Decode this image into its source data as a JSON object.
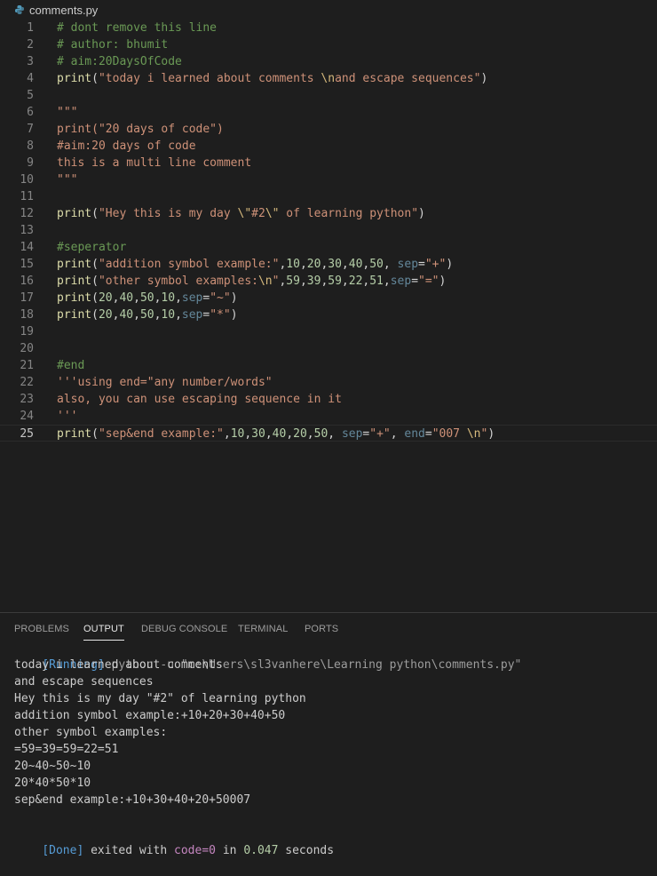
{
  "breadcrumb": {
    "file": "comments.py"
  },
  "editor": {
    "lines": [
      {
        "n": "1",
        "tokens": [
          {
            "t": "# dont remove this line",
            "c": "t-comment"
          }
        ]
      },
      {
        "n": "2",
        "tokens": [
          {
            "t": "# author: bhumit",
            "c": "t-comment"
          }
        ]
      },
      {
        "n": "3",
        "tokens": [
          {
            "t": "# aim:20DaysOfCode",
            "c": "t-comment"
          }
        ]
      },
      {
        "n": "4",
        "tokens": [
          {
            "t": "print",
            "c": "t-func"
          },
          {
            "t": "(",
            "c": "t-plain"
          },
          {
            "t": "\"today i learned about comments ",
            "c": "t-str"
          },
          {
            "t": "\\n",
            "c": "t-esc"
          },
          {
            "t": "and escape sequences\"",
            "c": "t-str"
          },
          {
            "t": ")",
            "c": "t-plain"
          }
        ]
      },
      {
        "n": "5",
        "tokens": []
      },
      {
        "n": "6",
        "tokens": [
          {
            "t": "\"\"\"",
            "c": "t-str"
          }
        ]
      },
      {
        "n": "7",
        "tokens": [
          {
            "t": "print(\"20 days of code\")",
            "c": "t-str"
          }
        ]
      },
      {
        "n": "8",
        "tokens": [
          {
            "t": "#aim:20 days of code",
            "c": "t-str"
          }
        ]
      },
      {
        "n": "9",
        "tokens": [
          {
            "t": "this is a multi line comment",
            "c": "t-str"
          }
        ]
      },
      {
        "n": "10",
        "tokens": [
          {
            "t": "\"\"\"",
            "c": "t-str"
          }
        ]
      },
      {
        "n": "11",
        "tokens": []
      },
      {
        "n": "12",
        "tokens": [
          {
            "t": "print",
            "c": "t-func"
          },
          {
            "t": "(",
            "c": "t-plain"
          },
          {
            "t": "\"Hey this is my day ",
            "c": "t-str"
          },
          {
            "t": "\\\"",
            "c": "t-esc"
          },
          {
            "t": "#2",
            "c": "t-str"
          },
          {
            "t": "\\\"",
            "c": "t-esc"
          },
          {
            "t": " of learning python\"",
            "c": "t-str"
          },
          {
            "t": ")",
            "c": "t-plain"
          }
        ]
      },
      {
        "n": "13",
        "tokens": []
      },
      {
        "n": "14",
        "tokens": [
          {
            "t": "#seperator",
            "c": "t-comment"
          }
        ]
      },
      {
        "n": "15",
        "tokens": [
          {
            "t": "print",
            "c": "t-func"
          },
          {
            "t": "(",
            "c": "t-plain"
          },
          {
            "t": "\"addition symbol example:\"",
            "c": "t-str"
          },
          {
            "t": ",",
            "c": "t-plain"
          },
          {
            "t": "10",
            "c": "t-num"
          },
          {
            "t": ",",
            "c": "t-plain"
          },
          {
            "t": "20",
            "c": "t-num"
          },
          {
            "t": ",",
            "c": "t-plain"
          },
          {
            "t": "30",
            "c": "t-num"
          },
          {
            "t": ",",
            "c": "t-plain"
          },
          {
            "t": "40",
            "c": "t-num"
          },
          {
            "t": ",",
            "c": "t-plain"
          },
          {
            "t": "50",
            "c": "t-num"
          },
          {
            "t": ", ",
            "c": "t-plain"
          },
          {
            "t": "sep",
            "c": "t-param"
          },
          {
            "t": "=",
            "c": "t-plain"
          },
          {
            "t": "\"+\"",
            "c": "t-str"
          },
          {
            "t": ")",
            "c": "t-plain"
          }
        ]
      },
      {
        "n": "16",
        "tokens": [
          {
            "t": "print",
            "c": "t-func"
          },
          {
            "t": "(",
            "c": "t-plain"
          },
          {
            "t": "\"other symbol examples:",
            "c": "t-str"
          },
          {
            "t": "\\n",
            "c": "t-esc"
          },
          {
            "t": "\"",
            "c": "t-str"
          },
          {
            "t": ",",
            "c": "t-plain"
          },
          {
            "t": "59",
            "c": "t-num"
          },
          {
            "t": ",",
            "c": "t-plain"
          },
          {
            "t": "39",
            "c": "t-num"
          },
          {
            "t": ",",
            "c": "t-plain"
          },
          {
            "t": "59",
            "c": "t-num"
          },
          {
            "t": ",",
            "c": "t-plain"
          },
          {
            "t": "22",
            "c": "t-num"
          },
          {
            "t": ",",
            "c": "t-plain"
          },
          {
            "t": "51",
            "c": "t-num"
          },
          {
            "t": ",",
            "c": "t-plain"
          },
          {
            "t": "sep",
            "c": "t-param"
          },
          {
            "t": "=",
            "c": "t-plain"
          },
          {
            "t": "\"=\"",
            "c": "t-str"
          },
          {
            "t": ")",
            "c": "t-plain"
          }
        ]
      },
      {
        "n": "17",
        "tokens": [
          {
            "t": "print",
            "c": "t-func"
          },
          {
            "t": "(",
            "c": "t-plain"
          },
          {
            "t": "20",
            "c": "t-num"
          },
          {
            "t": ",",
            "c": "t-plain"
          },
          {
            "t": "40",
            "c": "t-num"
          },
          {
            "t": ",",
            "c": "t-plain"
          },
          {
            "t": "50",
            "c": "t-num"
          },
          {
            "t": ",",
            "c": "t-plain"
          },
          {
            "t": "10",
            "c": "t-num"
          },
          {
            "t": ",",
            "c": "t-plain"
          },
          {
            "t": "sep",
            "c": "t-param"
          },
          {
            "t": "=",
            "c": "t-plain"
          },
          {
            "t": "\"~\"",
            "c": "t-str"
          },
          {
            "t": ")",
            "c": "t-plain"
          }
        ]
      },
      {
        "n": "18",
        "tokens": [
          {
            "t": "print",
            "c": "t-func"
          },
          {
            "t": "(",
            "c": "t-plain"
          },
          {
            "t": "20",
            "c": "t-num"
          },
          {
            "t": ",",
            "c": "t-plain"
          },
          {
            "t": "40",
            "c": "t-num"
          },
          {
            "t": ",",
            "c": "t-plain"
          },
          {
            "t": "50",
            "c": "t-num"
          },
          {
            "t": ",",
            "c": "t-plain"
          },
          {
            "t": "10",
            "c": "t-num"
          },
          {
            "t": ",",
            "c": "t-plain"
          },
          {
            "t": "sep",
            "c": "t-param"
          },
          {
            "t": "=",
            "c": "t-plain"
          },
          {
            "t": "\"*\"",
            "c": "t-str"
          },
          {
            "t": ")",
            "c": "t-plain"
          }
        ]
      },
      {
        "n": "19",
        "tokens": []
      },
      {
        "n": "20",
        "tokens": []
      },
      {
        "n": "21",
        "tokens": [
          {
            "t": "#end",
            "c": "t-comment"
          }
        ]
      },
      {
        "n": "22",
        "tokens": [
          {
            "t": "'''using end=\"any number/words\"",
            "c": "t-str"
          }
        ]
      },
      {
        "n": "23",
        "tokens": [
          {
            "t": "also, you can use escaping sequence in it",
            "c": "t-str"
          }
        ]
      },
      {
        "n": "24",
        "tokens": [
          {
            "t": "'''",
            "c": "t-str"
          }
        ]
      },
      {
        "n": "25",
        "tokens": [
          {
            "t": "print",
            "c": "t-func"
          },
          {
            "t": "(",
            "c": "t-plain"
          },
          {
            "t": "\"sep&end example:\"",
            "c": "t-str"
          },
          {
            "t": ",",
            "c": "t-plain"
          },
          {
            "t": "10",
            "c": "t-num"
          },
          {
            "t": ",",
            "c": "t-plain"
          },
          {
            "t": "30",
            "c": "t-num"
          },
          {
            "t": ",",
            "c": "t-plain"
          },
          {
            "t": "40",
            "c": "t-num"
          },
          {
            "t": ",",
            "c": "t-plain"
          },
          {
            "t": "20",
            "c": "t-num"
          },
          {
            "t": ",",
            "c": "t-plain"
          },
          {
            "t": "50",
            "c": "t-num"
          },
          {
            "t": ", ",
            "c": "t-plain"
          },
          {
            "t": "sep",
            "c": "t-param"
          },
          {
            "t": "=",
            "c": "t-plain"
          },
          {
            "t": "\"+\"",
            "c": "t-str"
          },
          {
            "t": ", ",
            "c": "t-plain"
          },
          {
            "t": "end",
            "c": "t-param"
          },
          {
            "t": "=",
            "c": "t-plain"
          },
          {
            "t": "\"007 ",
            "c": "t-str"
          },
          {
            "t": "\\n",
            "c": "t-esc"
          },
          {
            "t": "\"",
            "c": "t-str"
          },
          {
            "t": ")",
            "c": "t-plain"
          }
        ]
      }
    ],
    "active_line": "25"
  },
  "panel": {
    "tabs": [
      "PROBLEMS",
      "OUTPUT",
      "DEBUG CONSOLE",
      "TERMINAL",
      "PORTS"
    ],
    "active_tab": "OUTPUT"
  },
  "output": {
    "running_tag": "[Running]",
    "running_cmd": " python -u \"c:\\Users\\sl3vanhere\\Learning python\\comments.py\"",
    "lines": [
      "today i learned about comments",
      "and escape sequences",
      "Hey this is my day \"#2\" of learning python",
      "addition symbol example:+10+20+30+40+50",
      "other symbol examples:",
      "=59=39=59=22=51",
      "20~40~50~10",
      "20*40*50*10",
      "sep&end example:+10+30+40+20+50007"
    ],
    "done_tag": "[Done]",
    "done_text_1": " exited with ",
    "done_code": "code=0",
    "done_text_2": " in ",
    "done_time": "0.047",
    "done_text_3": " seconds"
  },
  "colors": {
    "background": "#1e1e1e",
    "python_icon": "#519aba"
  }
}
